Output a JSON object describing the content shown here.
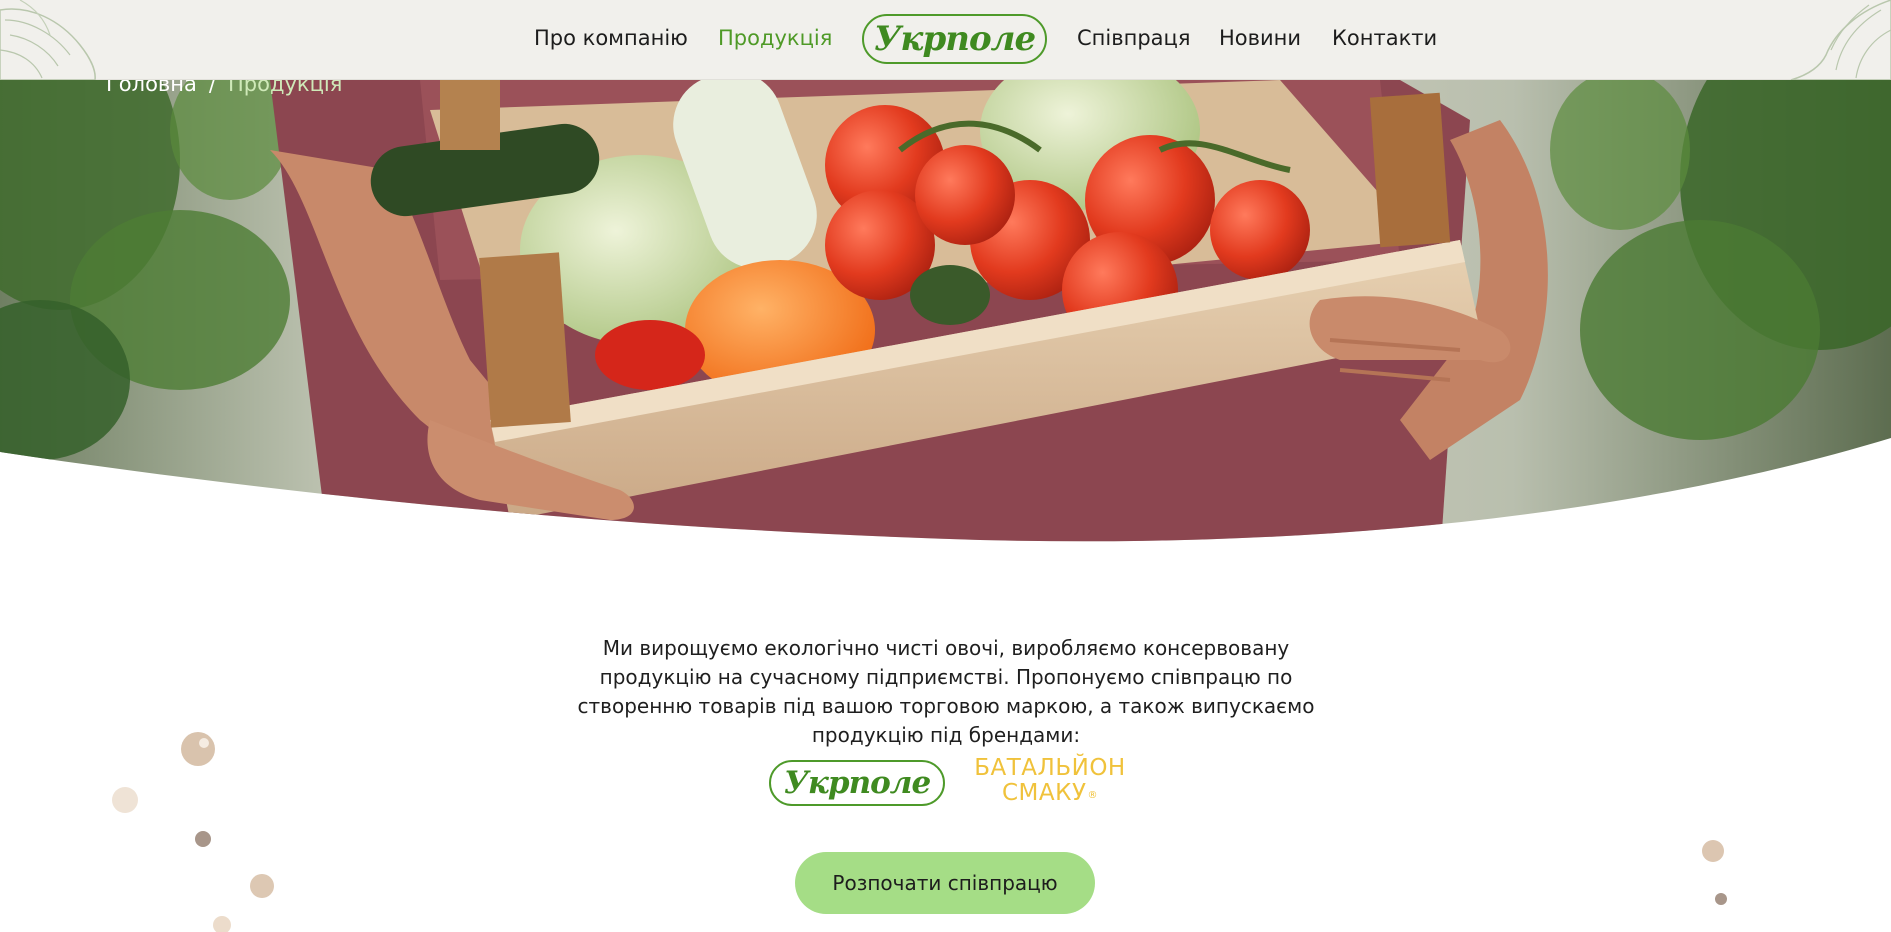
{
  "header": {
    "nav_left": [
      {
        "label": "Про компанію"
      },
      {
        "label": "Продукція",
        "active": true
      }
    ],
    "logo_text": "Укрполе",
    "nav_right": [
      {
        "label": "Співпраця"
      },
      {
        "label": "Новини"
      },
      {
        "label": "Контакти"
      }
    ]
  },
  "breadcrumb": {
    "home": "Головна",
    "separator": "/",
    "current": "Продукція"
  },
  "intro": {
    "text": "Ми вирощуємо екологічно чисті овочі, виробляємо консервовану продукцію на сучасному підприємстві. Пропонуємо співпрацю по створенню товарів під вашою торговою маркою, а також випускаємо продукцію під брендами:"
  },
  "brands": {
    "ukrpole": "Укрполе",
    "battalion_line1": "БАТАЛЬЙОН",
    "battalion_line2": "СМАКУ",
    "battalion_mark": "®"
  },
  "cta": {
    "label": "Розпочати співпрацю"
  },
  "colors": {
    "accent_green": "#4f9a27",
    "header_bg": "#f1f0ec",
    "cta_bg": "#a5dd86",
    "brand_yellow": "#f0c23b"
  }
}
